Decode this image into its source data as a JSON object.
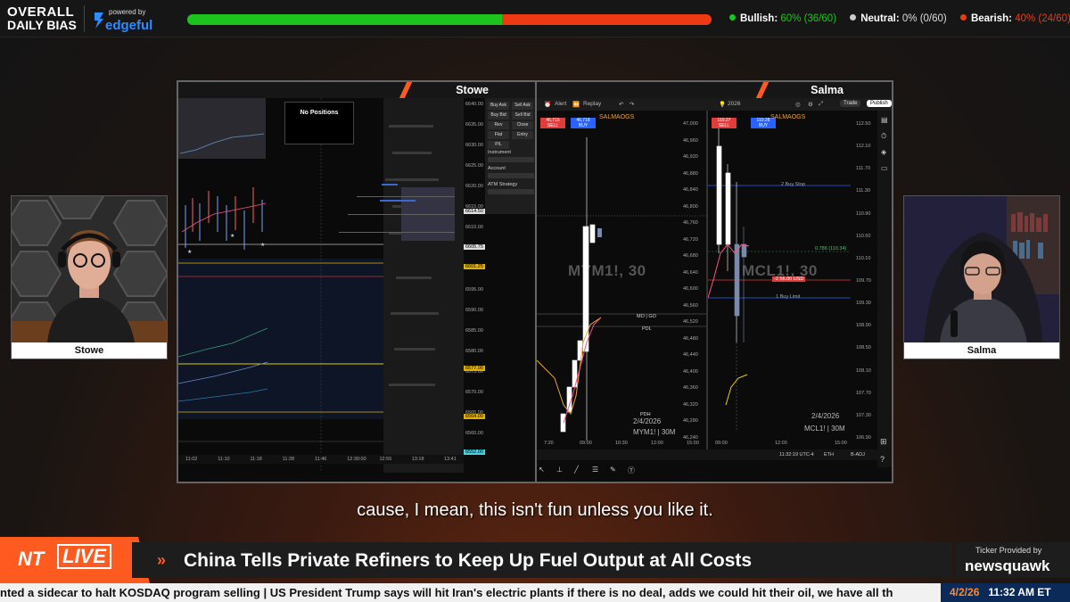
{
  "header": {
    "brand_line1": "OVERALL",
    "brand_line2": "DAILY BIAS",
    "powered_by": "powered by",
    "powered_name": "edgeful",
    "bias": {
      "bullish_fraction": 0.6,
      "bearish_fraction": 0.4,
      "bullish_label": "Bullish:",
      "bullish_value": "60% (36/60)",
      "neutral_label": "Neutral:",
      "neutral_value": "0% (0/60)",
      "bearish_label": "Bearish:",
      "bearish_value": "40% (24/60)",
      "colors": {
        "bullish": "#1ec41e",
        "neutral": "#cccccc",
        "bearish": "#ee3a14"
      }
    }
  },
  "cams": {
    "left_name": "Stowe",
    "right_name": "Salma"
  },
  "panel_left": {
    "title": "Stowe",
    "no_positions": "No Positions",
    "price_axis": [
      "6640.00",
      "6635.00",
      "6630.00",
      "6625.00",
      "6620.00",
      "6615.00",
      "6610.00",
      "6605.00",
      "6600.00",
      "6595.00",
      "6590.00",
      "6585.00",
      "6580.00",
      "6575.00",
      "6570.00",
      "6565.00",
      "6560.00",
      "6555.00"
    ],
    "tags": [
      "6614.50",
      "6605.75",
      "6601.25",
      "6577.00",
      "6564.00",
      "6552.00"
    ],
    "time_axis": [
      "11:02",
      "11:10",
      "11:18",
      "11:28",
      "11:46",
      "12:30:00",
      "12:55",
      "13:18",
      "13:41"
    ],
    "order_buttons": [
      "Buy Ask",
      "Sell Ask",
      "Buy Bid",
      "Sell Bid",
      "Rev",
      "Close",
      "Flat",
      "Entry",
      "P/L"
    ]
  },
  "panel_right": {
    "title": "Salma",
    "toolbar": {
      "alert": "Alert",
      "replay": "Replay",
      "trade": "Trade",
      "publish": "Publish",
      "date": "2026"
    },
    "left_chart": {
      "watermark": "MYM1!, 30",
      "symbol_footer": "MYM1! | 30M",
      "date_footer": "2/4/2026",
      "indicator": "SALMAOGS",
      "sell_price": "46,715",
      "buy_price": "46,718",
      "price_axis": [
        "47,000",
        "46,960",
        "46,920",
        "46,880",
        "46,840",
        "46,800",
        "46,760",
        "46,720",
        "46,680",
        "46,640",
        "46,600",
        "46,560",
        "46,520",
        "46,480",
        "46,440",
        "46,400",
        "46,360",
        "46,320",
        "46,280",
        "46,240"
      ],
      "time_axis": [
        "7:20",
        "09:00",
        "10:30",
        "12:00",
        "15:00"
      ],
      "labels": [
        "MO | GO",
        "PDL",
        "PDH"
      ]
    },
    "right_chart": {
      "watermark": "MCL1!, 30",
      "symbol_footer": "MCL1! | 30M",
      "date_footer": "2/4/2026",
      "indicator": "SALMAOGS",
      "sell_price": "110.27",
      "buy_price": "110.28",
      "price_axis": [
        "112.50",
        "112.10",
        "111.70",
        "111.30",
        "110.90",
        "110.50",
        "110.10",
        "109.70",
        "109.30",
        "108.90",
        "108.50",
        "108.10",
        "107.70",
        "107.30",
        "106.90"
      ],
      "time_axis": [
        "09:00",
        "12:00",
        "15:00"
      ],
      "buy_stop": "2 Buy Stop",
      "buy_limit": "1 Buy Limit",
      "position": "-2  56.00 USD",
      "fib": "0.786 (110.34)",
      "status": "11:32:19 UTC-4",
      "eth": "ETH",
      "badj": "B-ADJ"
    }
  },
  "caption": "cause, I mean, this isn't fun unless you like it.",
  "news": {
    "live_nt": "NT",
    "live_label": "LIVE",
    "headline": "China Tells Private Refiners to Keep Up Fuel Output at All Costs",
    "ticker_provided": "Ticker Provided by",
    "ticker_brand": "newsquawk",
    "ticker_text": "nted a sidecar to halt KOSDAQ program selling   |   US President Trump says will hit Iran's electric plants if there is no deal, adds we could hit their oil, we have all th",
    "date": "4/2/26",
    "time": "11:32 AM ET"
  }
}
